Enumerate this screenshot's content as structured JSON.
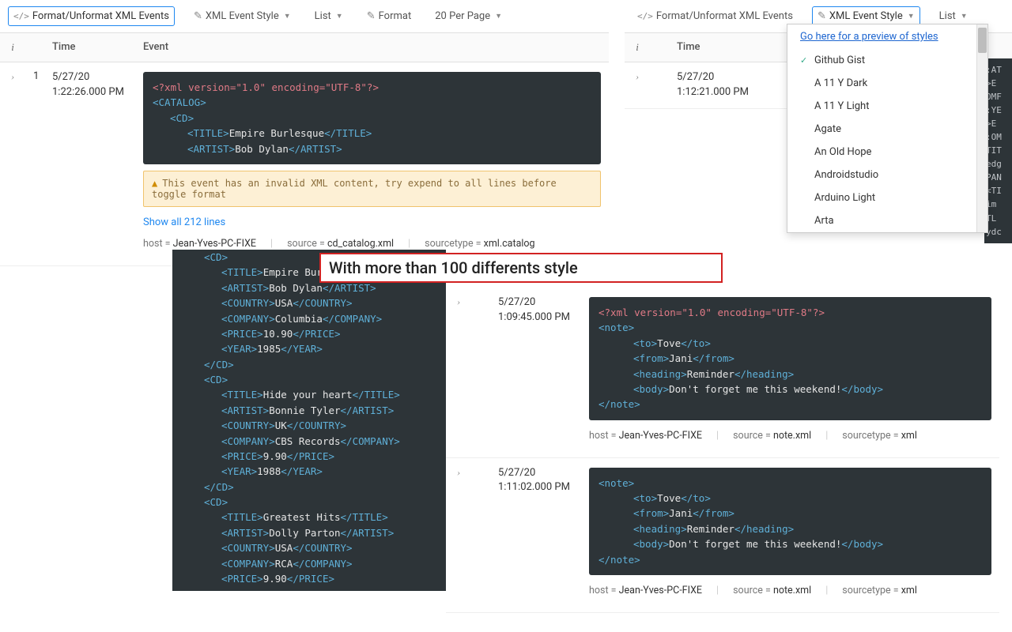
{
  "toolbar": {
    "format_unformat": "Format/Unformat XML Events",
    "xml_event_style": "XML Event Style",
    "list": "List",
    "format": "Format",
    "per_page": "20 Per Page"
  },
  "columns": {
    "i": "i",
    "time": "Time",
    "event": "Event"
  },
  "left": {
    "rownum": "1",
    "date": "5/27/20",
    "time": "1:22:26.000 PM",
    "xml_lines": [
      {
        "cls": "xml-decl",
        "indent": 0,
        "text": "<?xml version=\"1.0\" encoding=\"UTF-8\"?>"
      },
      {
        "cls": "tag",
        "indent": 0,
        "text": "<CATALOG>"
      },
      {
        "cls": "tag",
        "indent": 1,
        "text": "<CD>"
      },
      {
        "cls": "pair",
        "indent": 2,
        "open": "<TITLE>",
        "txt": "Empire Burlesque",
        "close": "</TITLE>"
      },
      {
        "cls": "pair",
        "indent": 2,
        "open": "<ARTIST>",
        "txt": "Bob Dylan",
        "close": "</ARTIST>"
      }
    ],
    "warning": "This event has an invalid XML content, try expend to all lines before toggle format",
    "show_all": "Show all 212 lines",
    "meta": {
      "host": "Jean-Yves-PC-FIXE",
      "source": "cd_catalog.xml",
      "sourcetype": "xml.catalog"
    }
  },
  "right": {
    "date": "5/27/20",
    "time": "1:12:21.000 PM",
    "dropdown_link": "Go here for a preview of styles",
    "styles": [
      "Github Gist",
      "A 11 Y Dark",
      "A 11 Y Light",
      "Agate",
      "An Old Hope",
      "Androidstudio",
      "Arduino Light",
      "Arta"
    ],
    "trunc_hints": [
      ":AT",
      ">E",
      "OMF",
      ":YE",
      ">E",
      ":OM",
      "TIT",
      "edg",
      "PAN",
      "<TI",
      "im",
      "TL",
      "ydc"
    ]
  },
  "callout": "With more than 100 differents style",
  "code_cont": [
    {
      "i": 1,
      "open": "<CD>",
      "txt": "",
      "close": ""
    },
    {
      "i": 2,
      "open": "<TITLE>",
      "txt": "Empire Burles",
      "close": ""
    },
    {
      "i": 2,
      "open": "<ARTIST>",
      "txt": "Bob Dylan",
      "close": "</ARTIST>"
    },
    {
      "i": 2,
      "open": "<COUNTRY>",
      "txt": "USA",
      "close": "</COUNTRY>"
    },
    {
      "i": 2,
      "open": "<COMPANY>",
      "txt": "Columbia",
      "close": "</COMPANY>"
    },
    {
      "i": 2,
      "open": "<PRICE>",
      "txt": "10.90",
      "close": "</PRICE>"
    },
    {
      "i": 2,
      "open": "<YEAR>",
      "txt": "1985",
      "close": "</YEAR>"
    },
    {
      "i": 1,
      "open": "</CD>",
      "txt": "",
      "close": ""
    },
    {
      "i": 1,
      "open": "<CD>",
      "txt": "",
      "close": ""
    },
    {
      "i": 2,
      "open": "<TITLE>",
      "txt": "Hide your heart",
      "close": "</TITLE>"
    },
    {
      "i": 2,
      "open": "<ARTIST>",
      "txt": "Bonnie Tyler",
      "close": "</ARTIST>"
    },
    {
      "i": 2,
      "open": "<COUNTRY>",
      "txt": "UK",
      "close": "</COUNTRY>"
    },
    {
      "i": 2,
      "open": "<COMPANY>",
      "txt": "CBS Records",
      "close": "</COMPANY>"
    },
    {
      "i": 2,
      "open": "<PRICE>",
      "txt": "9.90",
      "close": "</PRICE>"
    },
    {
      "i": 2,
      "open": "<YEAR>",
      "txt": "1988",
      "close": "</YEAR>"
    },
    {
      "i": 1,
      "open": "</CD>",
      "txt": "",
      "close": ""
    },
    {
      "i": 1,
      "open": "<CD>",
      "txt": "",
      "close": ""
    },
    {
      "i": 2,
      "open": "<TITLE>",
      "txt": "Greatest Hits",
      "close": "</TITLE>"
    },
    {
      "i": 2,
      "open": "<ARTIST>",
      "txt": "Dolly Parton",
      "close": "</ARTIST>"
    },
    {
      "i": 2,
      "open": "<COUNTRY>",
      "txt": "USA",
      "close": "</COUNTRY>"
    },
    {
      "i": 2,
      "open": "<COMPANY>",
      "txt": "RCA",
      "close": "</COMPANY>"
    },
    {
      "i": 2,
      "open": "<PRICE>",
      "txt": "9.90",
      "close": "</PRICE>"
    }
  ],
  "rightEvents": [
    {
      "date": "5/27/20",
      "time": "1:09:45.000 PM",
      "lines": [
        {
          "cls": "xml-decl",
          "i": 0,
          "text": "<?xml version=\"1.0\" encoding=\"UTF-8\"?>"
        },
        {
          "cls": "tag",
          "i": 0,
          "text": "<note>"
        },
        {
          "cls": "pair",
          "i": 2,
          "open": "<to>",
          "txt": "Tove",
          "close": "</to>"
        },
        {
          "cls": "pair",
          "i": 2,
          "open": "<from>",
          "txt": "Jani",
          "close": "</from>"
        },
        {
          "cls": "pair",
          "i": 2,
          "open": "<heading>",
          "txt": "Reminder",
          "close": "</heading>"
        },
        {
          "cls": "pair",
          "i": 2,
          "open": "<body>",
          "txt": "Don't forget me this weekend!",
          "close": "</body>"
        },
        {
          "cls": "tag",
          "i": 0,
          "text": "</note>"
        }
      ],
      "meta": {
        "host": "Jean-Yves-PC-FIXE",
        "source": "note.xml",
        "sourcetype": "xml"
      }
    },
    {
      "date": "5/27/20",
      "time": "1:11:02.000 PM",
      "lines": [
        {
          "cls": "tag",
          "i": 0,
          "text": "<note>"
        },
        {
          "cls": "pair",
          "i": 2,
          "open": "<to>",
          "txt": "Tove",
          "close": "</to>"
        },
        {
          "cls": "pair",
          "i": 2,
          "open": "<from>",
          "txt": "Jani",
          "close": "</from>"
        },
        {
          "cls": "pair",
          "i": 2,
          "open": "<heading>",
          "txt": "Reminder",
          "close": "</heading>"
        },
        {
          "cls": "pair",
          "i": 2,
          "open": "<body>",
          "txt": "Don't forget me this weekend!",
          "close": "</body>"
        },
        {
          "cls": "tag",
          "i": 0,
          "text": "</note>"
        }
      ],
      "meta": {
        "host": "Jean-Yves-PC-FIXE",
        "source": "note.xml",
        "sourcetype": "xml"
      }
    }
  ],
  "labels": {
    "host": "host",
    "source": "source",
    "sourcetype": "sourcetype",
    "eq": " = "
  }
}
